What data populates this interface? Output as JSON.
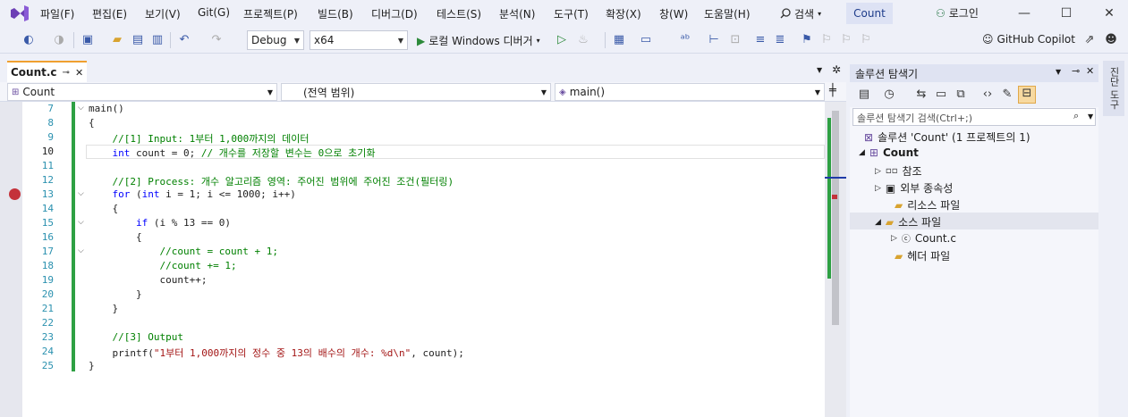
{
  "menu": [
    "파일(F)",
    "편집(E)",
    "보기(V)",
    "Git(G)",
    "프로젝트(P)",
    "빌드(B)",
    "디버그(D)",
    "테스트(S)",
    "분석(N)",
    "도구(T)",
    "확장(X)",
    "창(W)",
    "도움말(H)"
  ],
  "search_label": "검색",
  "window_title": "Count",
  "login_label": "로그인",
  "toolbar": {
    "config": "Debug",
    "platform": "x64",
    "run_label": "로컬 Windows 디버거",
    "copilot": "GitHub Copilot"
  },
  "tab": {
    "name": "Count.c"
  },
  "nav": {
    "project": "Count",
    "scope": "(전역 범위)",
    "member": "main()"
  },
  "code": [
    {
      "n": "7",
      "t": "main()"
    },
    {
      "n": "8",
      "t": "{"
    },
    {
      "n": "9",
      "t": "    //[1] Input: 1부터 1,000까지의 데이터"
    },
    {
      "n": "10",
      "t": "    int count = 0; // 개수를 저장할 변수는 0으로 초기화"
    },
    {
      "n": "11",
      "t": ""
    },
    {
      "n": "12",
      "t": "    //[2] Process: 개수 알고리즘 영역: 주어진 범위에 주어진 조건(필터링)"
    },
    {
      "n": "13",
      "t": "    for (int i = 1; i <= 1000; i++)"
    },
    {
      "n": "14",
      "t": "    {"
    },
    {
      "n": "15",
      "t": "        if (i % 13 == 0)"
    },
    {
      "n": "16",
      "t": "        {"
    },
    {
      "n": "17",
      "t": "            //count = count + 1;"
    },
    {
      "n": "18",
      "t": "            //count += 1;"
    },
    {
      "n": "19",
      "t": "            count++;"
    },
    {
      "n": "20",
      "t": "        }"
    },
    {
      "n": "21",
      "t": "    }"
    },
    {
      "n": "22",
      "t": ""
    },
    {
      "n": "23",
      "t": "    //[3] Output"
    },
    {
      "n": "24",
      "t": "    printf(\"1부터 1,000까지의 정수 중 13의 배수의 개수: %d\\n\", count);"
    },
    {
      "n": "25",
      "t": "}"
    }
  ],
  "solution_explorer": {
    "title": "솔루션 탐색기",
    "search_placeholder": "솔루션 탐색기 검색(Ctrl+;)",
    "solution": "솔루션 'Count' (1 프로젝트의 1)",
    "project": "Count",
    "references": "참조",
    "external": "외부 종속성",
    "resources": "리소스 파일",
    "sources": "소스 파일",
    "source_file": "Count.c",
    "headers": "헤더 파일"
  },
  "right_tab": "진단 도구",
  "colors": {
    "accent": "#f0a030",
    "change_bar": "#2ea043",
    "breakpoint": "#c4323a"
  }
}
